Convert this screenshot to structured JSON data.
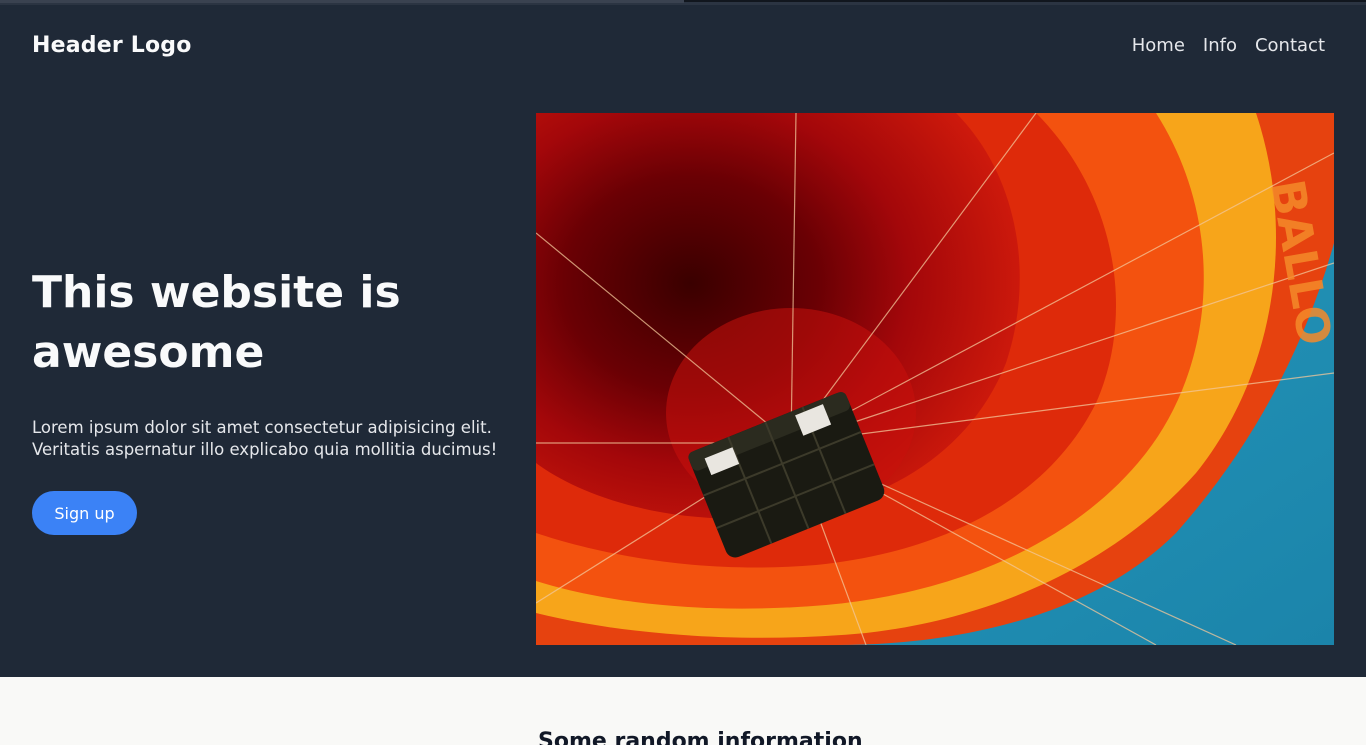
{
  "header": {
    "logo": "Header Logo",
    "nav": [
      "Home",
      "Info",
      "Contact"
    ]
  },
  "hero": {
    "title": "This website is awesome",
    "description": "Lorem ipsum dolor sit amet consectetur adipisicing elit. Veritatis aspernatur illo explicabo quia mollitia ducimus!",
    "cta_label": "Sign up",
    "image_alt": "hot-air-balloon-photo"
  },
  "info": {
    "title": "Some random information"
  },
  "colors": {
    "background": "#1f2937",
    "accent": "#3b82f6",
    "section_bg": "#f9f9f7"
  }
}
